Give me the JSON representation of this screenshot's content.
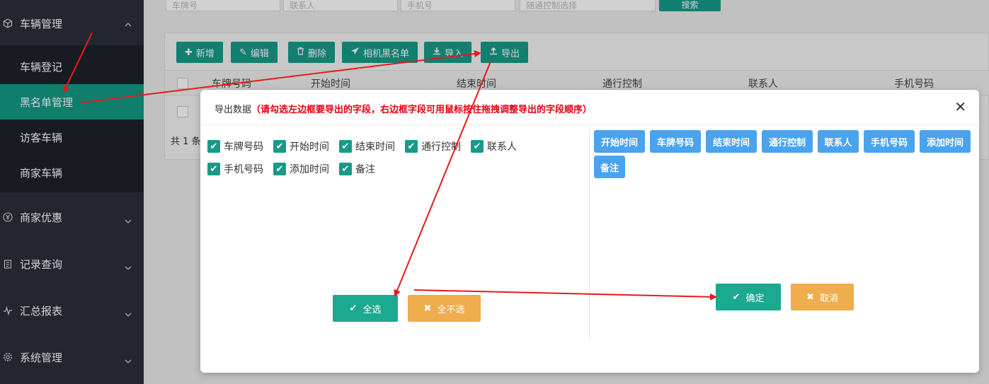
{
  "sidebar": {
    "groups": [
      {
        "label": "车辆管理",
        "icon": "cube-icon"
      },
      {
        "label": "商家优惠",
        "icon": "yen-icon"
      },
      {
        "label": "记录查询",
        "icon": "clipboard-icon"
      },
      {
        "label": "汇总报表",
        "icon": "pulse-icon"
      },
      {
        "label": "系统管理",
        "icon": "gear-icon"
      }
    ],
    "sub_items": [
      "车辆登记",
      "黑名单管理",
      "访客车辆",
      "商家车辆"
    ]
  },
  "toolbar": {
    "add": "新增",
    "edit": "编辑",
    "delete": "删除",
    "camera_blacklist": "相机黑名单",
    "import": "导入",
    "export": "导出",
    "search": "搜索"
  },
  "search_placeholders": [
    "车牌号",
    "联系人",
    "手机号",
    "随通控制选择"
  ],
  "table": {
    "headers": [
      "车牌号码",
      "开始时间",
      "结束时间",
      "通行控制",
      "联系人",
      "手机号码"
    ],
    "total": "共 1 条"
  },
  "modal": {
    "title": "导出数据",
    "hint": "（请勾选左边框要导出的字段，右边框字段可用鼠标按住拖拽调整导出的字段顺序）",
    "left_fields": [
      "车牌号码",
      "开始时间",
      "结束时间",
      "通行控制",
      "联系人",
      "手机号码",
      "添加时间",
      "备注"
    ],
    "right_fields": [
      "开始时间",
      "车牌号码",
      "结束时间",
      "通行控制",
      "联系人",
      "手机号码",
      "添加时间",
      "备注"
    ],
    "select_all": "全选",
    "select_none": "全不选",
    "confirm": "确定",
    "cancel": "取消"
  },
  "colors": {
    "sidebar_bg": "#2b2f3a",
    "active": "#139a86",
    "primary": "#179b89",
    "tag": "#4aa3ee",
    "warn": "#efad4e",
    "hint": "#e60012",
    "annotation_arrow": "#e8191e"
  }
}
